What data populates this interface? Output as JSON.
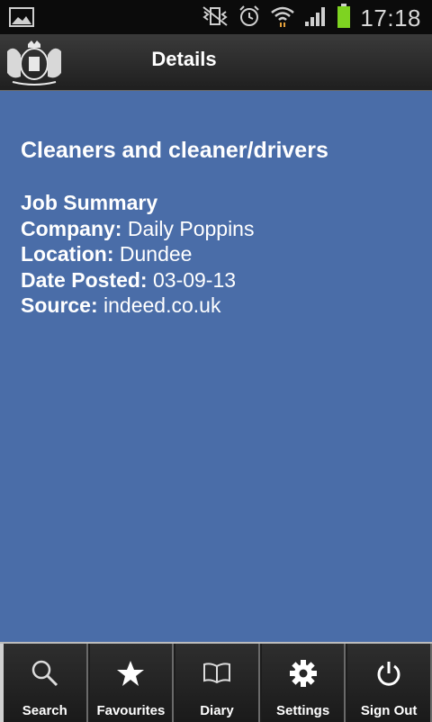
{
  "status_bar": {
    "time": "17:18"
  },
  "header": {
    "title": "Details"
  },
  "job": {
    "title": "Cleaners and cleaner/drivers",
    "summary_heading": "Job Summary",
    "company_label": "Company:",
    "company": "Daily Poppins",
    "location_label": "Location:",
    "location": "Dundee",
    "date_label": "Date Posted:",
    "date": "03-09-13",
    "source_label": "Source:",
    "source": "indeed.co.uk"
  },
  "tabs": [
    {
      "label": "Search",
      "icon": "search-icon"
    },
    {
      "label": "Favourites",
      "icon": "star-icon"
    },
    {
      "label": "Diary",
      "icon": "book-icon"
    },
    {
      "label": "Settings",
      "icon": "gear-icon"
    },
    {
      "label": "Sign Out",
      "icon": "power-icon"
    }
  ],
  "colors": {
    "content_bg": "#4a6da8",
    "battery": "#7ed321"
  }
}
